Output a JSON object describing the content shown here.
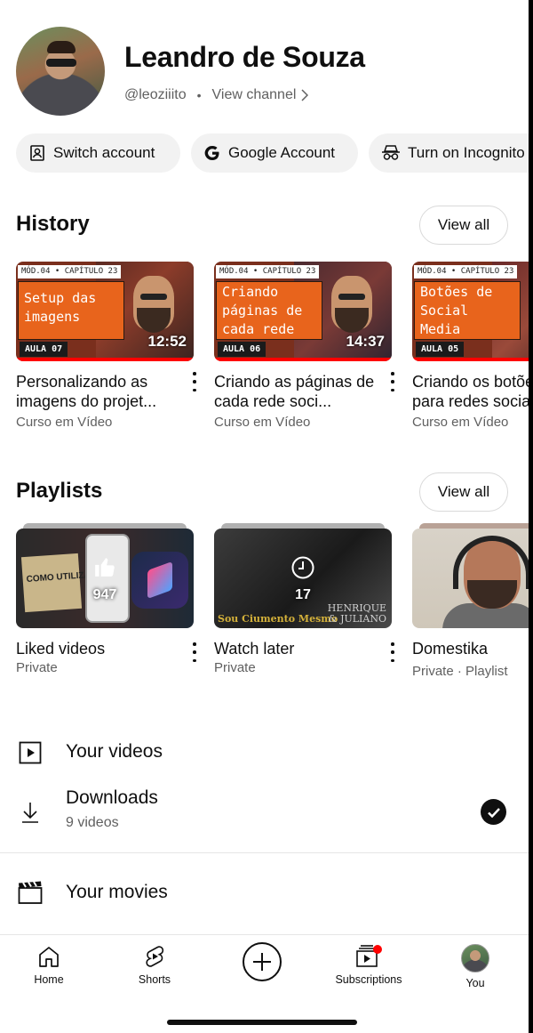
{
  "profile": {
    "name": "Leandro de Souza",
    "handle": "@leoziiito",
    "separator": "•",
    "view_channel": "View channel"
  },
  "chips": [
    {
      "label": "Switch account",
      "icon": "switch-account-icon"
    },
    {
      "label": "Google Account",
      "icon": "google-g-icon"
    },
    {
      "label": "Turn on Incognito",
      "icon": "incognito-icon"
    }
  ],
  "history": {
    "title": "History",
    "view_all": "View all",
    "items": [
      {
        "module": "MÓD.04 • CAPÍTULO 23",
        "thumb_text": "Setup das\nimagens",
        "lesson": "AULA 07",
        "duration": "12:52",
        "progress_percent": 100,
        "title": "Personalizando as imagens do projet...",
        "channel": "Curso em Vídeo"
      },
      {
        "module": "MÓD.04 • CAPÍTULO 23",
        "thumb_text": "Criando\npáginas de\ncada rede",
        "lesson": "AULA 06",
        "duration": "14:37",
        "progress_percent": 100,
        "title": "Criando as páginas de cada rede soci...",
        "channel": "Curso em Vídeo"
      },
      {
        "module": "MÓD.04 • CAPÍTULO 23",
        "thumb_text": "Botões de\nSocial\nMedia",
        "lesson": "AULA 05",
        "duration": "",
        "progress_percent": 100,
        "title": "Criando os botões para redes sociais",
        "channel": "Curso em Vídeo"
      }
    ]
  },
  "playlists": {
    "title": "Playlists",
    "view_all": "View all",
    "items": [
      {
        "title": "Liked videos",
        "sub": "Private",
        "count": "947",
        "thumb_text": "COMO UTILIZAR",
        "icon": "thumbs-up-icon"
      },
      {
        "title": "Watch later",
        "sub": "Private",
        "count": "17",
        "caption_a": "Sou Ciumento Mesmo",
        "caption_b": "HENRIQUE\n& JULIANO",
        "icon": "clock-icon"
      },
      {
        "title": "Domestika",
        "sub": "Private · Playlist"
      }
    ]
  },
  "rows": {
    "your_videos": "Your videos",
    "downloads": "Downloads",
    "downloads_sub": "9 videos",
    "your_movies": "Your movies"
  },
  "nav": {
    "home": "Home",
    "shorts": "Shorts",
    "subscriptions": "Subscriptions",
    "you": "You"
  },
  "colors": {
    "accent_red": "#ff0000",
    "thumb_orange": "#e8641c",
    "secondary_text": "#606060",
    "chip_bg": "#f2f2f2"
  }
}
